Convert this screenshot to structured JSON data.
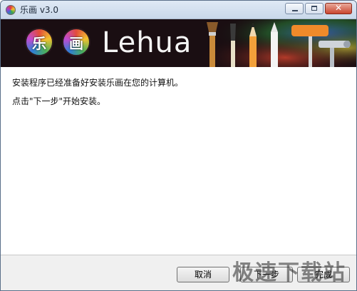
{
  "window": {
    "title": "乐画 v3.0",
    "controls": {
      "minimize_icon": "minimize-icon",
      "maximize_icon": "maximize-icon",
      "close_icon": "close-icon",
      "close_glyph": "✕"
    }
  },
  "banner": {
    "logo_char_1": "乐",
    "logo_char_2": "画",
    "logo_text": "Lehua",
    "background_color": "#1a0e12"
  },
  "body": {
    "line1": "安装程序已经准备好安装乐画在您的计算机。",
    "line2": "点击\"下一步\"开始安装。"
  },
  "buttons": {
    "cancel_label": "取消",
    "next_label": "下一步",
    "finish_label": "完成"
  },
  "watermark": {
    "text": "极速下载站"
  }
}
